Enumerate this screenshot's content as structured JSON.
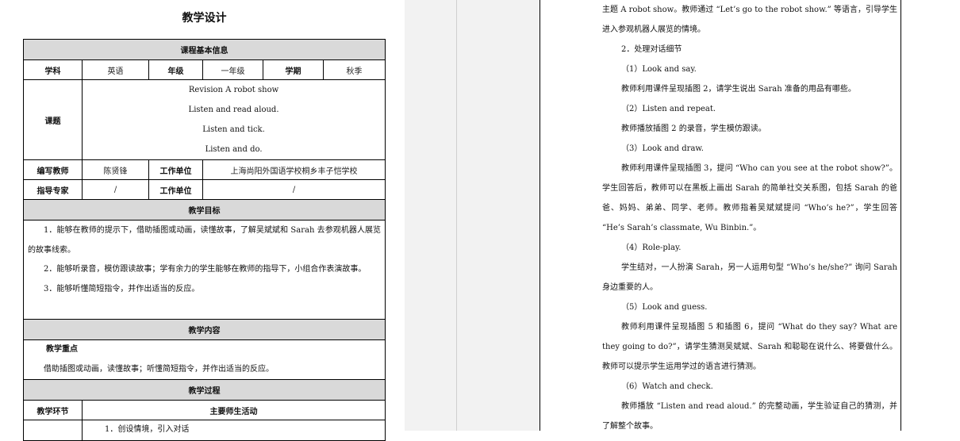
{
  "left_page": {
    "title": "教学设计",
    "basic_info": {
      "section_title": "课程基本信息",
      "subject_label": "学科",
      "subject_value": "英语",
      "grade_label": "年级",
      "grade_value": "一年级",
      "term_label": "学期",
      "term_value": "秋季",
      "topic_label": "课题",
      "topic_lines": [
        "Revision A robot show",
        "Listen and read aloud.",
        "Listen and tick.",
        "Listen and do."
      ],
      "author_label": "编写教师",
      "author_value": "陈贤锋",
      "unit_label": "工作单位",
      "unit_value": "上海尚阳外国语学校桐乡丰子恺学校",
      "advisor_label": "指导专家",
      "advisor_value": "/",
      "unit2_label": "工作单位",
      "unit2_value": "/"
    },
    "goals": {
      "section_title": "教学目标",
      "items": [
        "1．能够在教师的提示下，借助插图或动画，读懂故事，了解吴斌斌和 Sarah 去参观机器人展览的故事线索。",
        "2．能够听录音，模仿跟读故事；学有余力的学生能够在教师的指导下，小组合作表演故事。",
        "3．能够听懂简短指令，并作出适当的反应。"
      ]
    },
    "content": {
      "section_title": "教学内容",
      "key_heading": "教学重点",
      "key_text": "借助插图或动画，读懂故事；听懂简短指令，并作出适当的反应。"
    },
    "process": {
      "section_title": "教学过程",
      "col1": "教学环节",
      "col2": "主要师生活动",
      "first_row_text": "1．创设情境，引入对话"
    }
  },
  "right_page": {
    "paragraphs": [
      "主题 A robot show。教师通过 “Let’s go to the robot show.” 等语言，引导学生进入参观机器人展览的情境。",
      "2．处理对话细节",
      "（1）Look and say.",
      "教师利用课件呈现插图 2，请学生说出 Sarah 准备的用品有哪些。",
      "（2）Listen and repeat.",
      "教师播放插图 2 的录音，学生模仿跟读。",
      "（3）Look and draw.",
      "教师利用课件呈现插图 3，提问 “Who can you see at the robot show?”。学生回答后，教师可以在黑板上画出 Sarah 的简单社交关系图，包括 Sarah 的爸爸、妈妈、弟弟、同学、老师。教师指着吴斌斌提问 “Who’s he?”，学生回答 “He’s Sarah’s classmate, Wu Binbin.”。",
      "（4）Role-play.",
      "学生结对，一人扮演 Sarah，另一人运用句型 “Who’s he/she?” 询问 Sarah 身边重要的人。",
      "（5）Look and guess.",
      "教师利用课件呈现插图 5 和插图 6，提问 “What do they say? What are they going to do?”，请学生猜测吴斌斌、Sarah 和聪聪在说什么、将要做什么。教师可以提示学生运用学过的语言进行猜测。",
      "（6）Watch and check.",
      "教师播放 “Listen and read aloud.” 的完整动画，学生验证自己的猜测，并了解整个故事。"
    ]
  }
}
